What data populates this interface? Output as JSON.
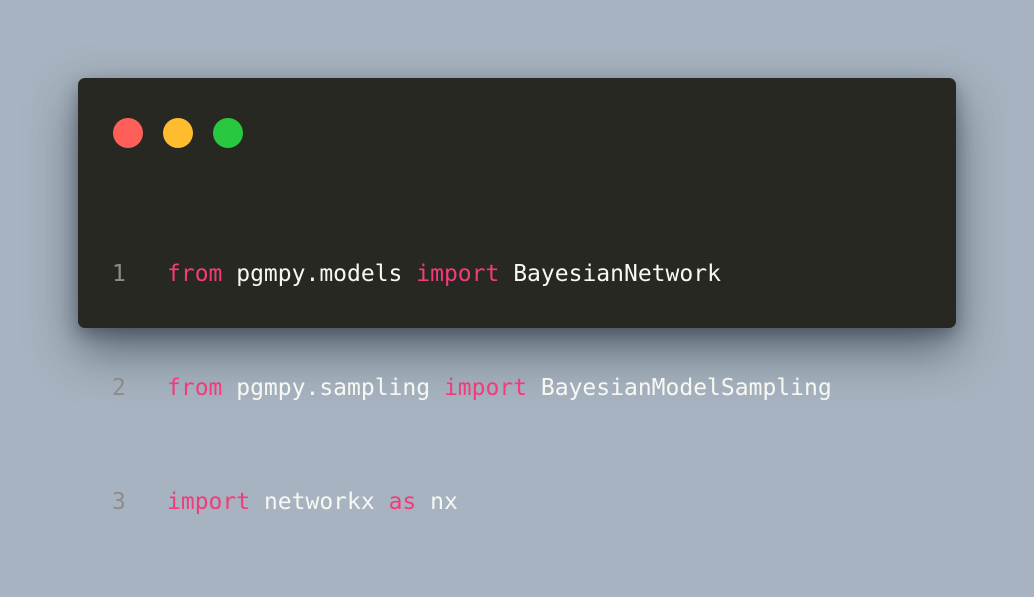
{
  "colors": {
    "background": "#a7b3c0",
    "window": "#282823",
    "keyword": "#f23b7a",
    "text": "#f8f8f2",
    "line_number": "#8c8c88"
  },
  "window_controls": [
    {
      "icon": "close-dot-icon",
      "color": "#fe5f58"
    },
    {
      "icon": "minimize-dot-icon",
      "color": "#febc2e"
    },
    {
      "icon": "zoom-dot-icon",
      "color": "#28c840"
    }
  ],
  "code": {
    "lines": [
      {
        "number": "1",
        "tokens": [
          {
            "text": "from",
            "type": "keyword"
          },
          {
            "text": " pgmpy.models ",
            "type": "text"
          },
          {
            "text": "import",
            "type": "keyword"
          },
          {
            "text": " BayesianNetwork",
            "type": "text"
          }
        ]
      },
      {
        "number": "2",
        "tokens": [
          {
            "text": "from",
            "type": "keyword"
          },
          {
            "text": " pgmpy.sampling ",
            "type": "text"
          },
          {
            "text": "import",
            "type": "keyword"
          },
          {
            "text": " BayesianModelSampling",
            "type": "text"
          }
        ]
      },
      {
        "number": "3",
        "tokens": [
          {
            "text": "import",
            "type": "keyword"
          },
          {
            "text": " networkx ",
            "type": "text"
          },
          {
            "text": "as",
            "type": "keyword"
          },
          {
            "text": " nx",
            "type": "text"
          }
        ]
      }
    ]
  }
}
